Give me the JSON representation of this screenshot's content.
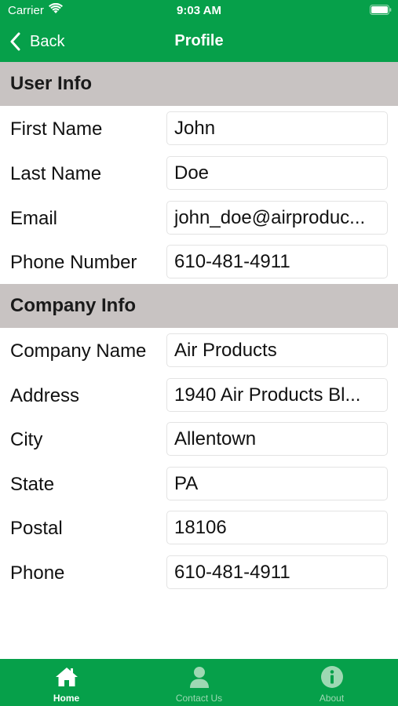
{
  "status_bar": {
    "carrier": "Carrier",
    "time": "9:03 AM"
  },
  "nav": {
    "back_label": "Back",
    "title": "Profile"
  },
  "sections": {
    "user_info": {
      "title": "User Info",
      "rows": [
        {
          "label": "First Name",
          "value": "John"
        },
        {
          "label": "Last Name",
          "value": "Doe"
        },
        {
          "label": "Email",
          "value": "john_doe@airproduc..."
        },
        {
          "label": "Phone Number",
          "value": "610-481-4911"
        }
      ]
    },
    "company_info": {
      "title": "Company Info",
      "rows": [
        {
          "label": "Company Name",
          "value": "Air Products"
        },
        {
          "label": "Address",
          "value": "1940 Air Products Bl..."
        },
        {
          "label": "City",
          "value": "Allentown"
        },
        {
          "label": "State",
          "value": "PA"
        },
        {
          "label": "Postal",
          "value": "18106"
        },
        {
          "label": "Phone",
          "value": "610-481-4911"
        }
      ]
    }
  },
  "tab_bar": {
    "tabs": [
      {
        "label": "Home",
        "icon": "home-icon",
        "active": true
      },
      {
        "label": "Contact Us",
        "icon": "person-icon",
        "active": false
      },
      {
        "label": "About",
        "icon": "info-icon",
        "active": false
      }
    ]
  },
  "colors": {
    "brand_green": "#06a04a",
    "section_header_bg": "#c8c3c2",
    "inactive_tab": "#9ed8b3"
  }
}
